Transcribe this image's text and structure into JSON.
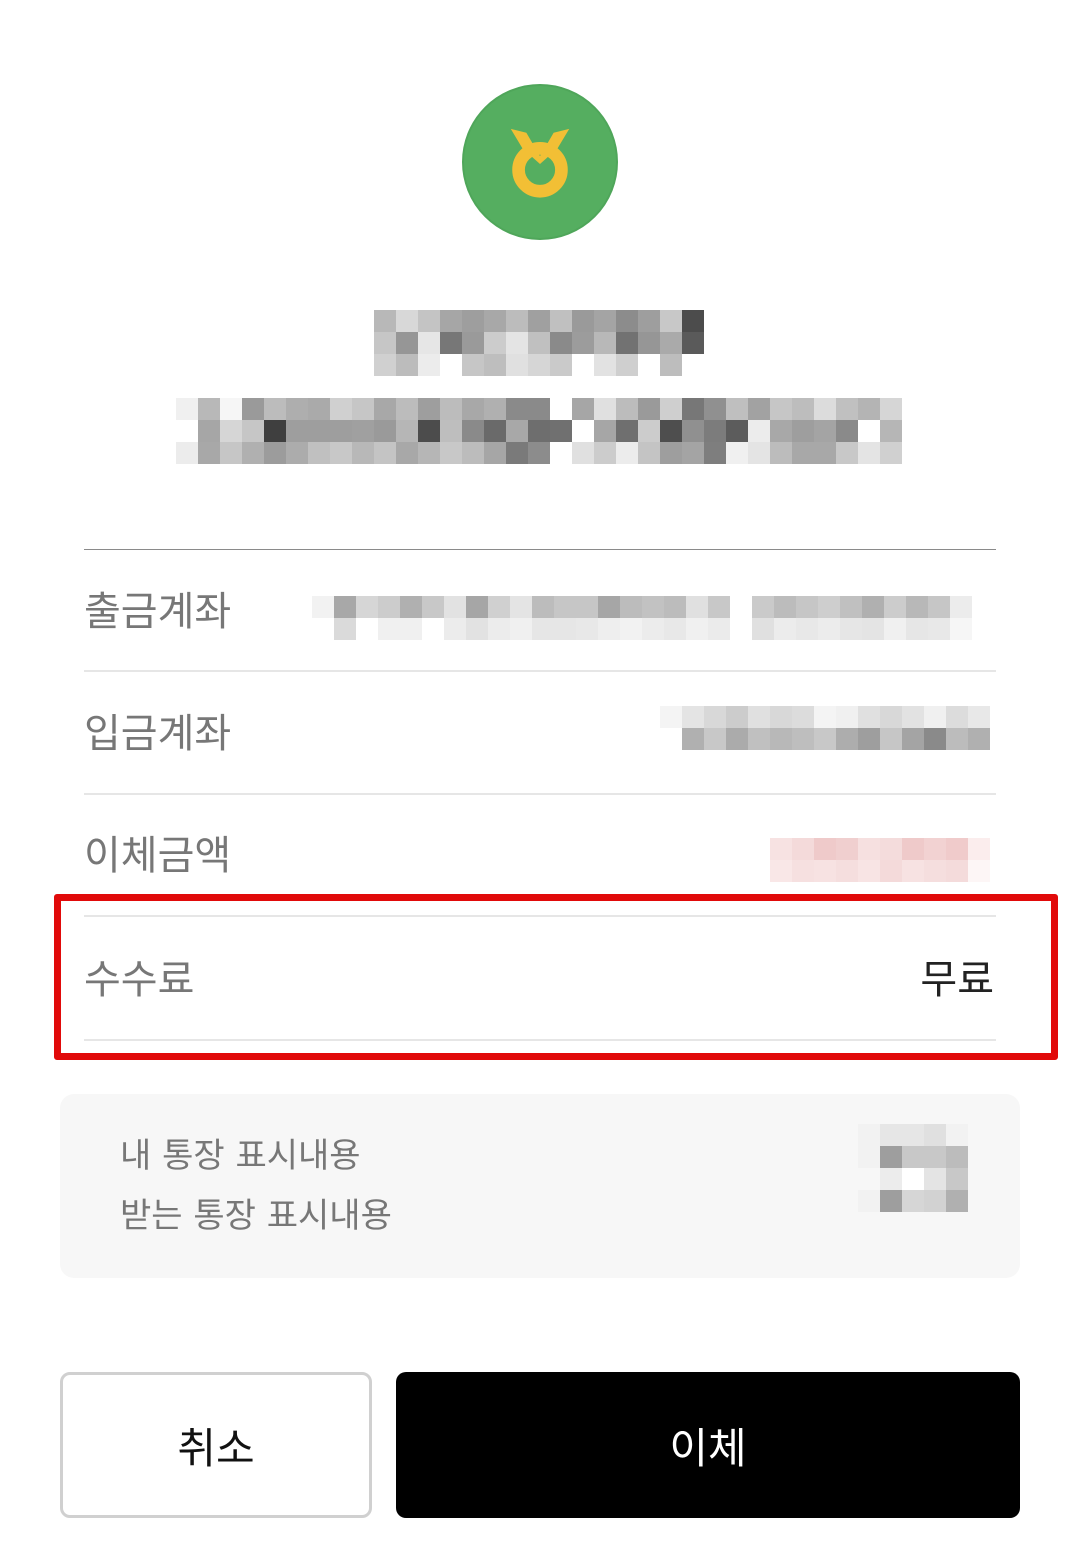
{
  "bank": {
    "logo_icon": "nh-bank-logo-icon",
    "logo_bg": "#55ae60",
    "logo_fg": "#f2bf35"
  },
  "rows": [
    {
      "label": "출금계좌"
    },
    {
      "label": "입금계좌"
    },
    {
      "label": "이체금액"
    },
    {
      "label": "수수료",
      "value": "무료"
    }
  ],
  "memo": {
    "my_label": "내 통장 표시내용",
    "recipient_label": "받는 통장 표시내용"
  },
  "buttons": {
    "cancel": "취소",
    "transfer": "이체"
  },
  "highlight_color": "#e10a0a"
}
